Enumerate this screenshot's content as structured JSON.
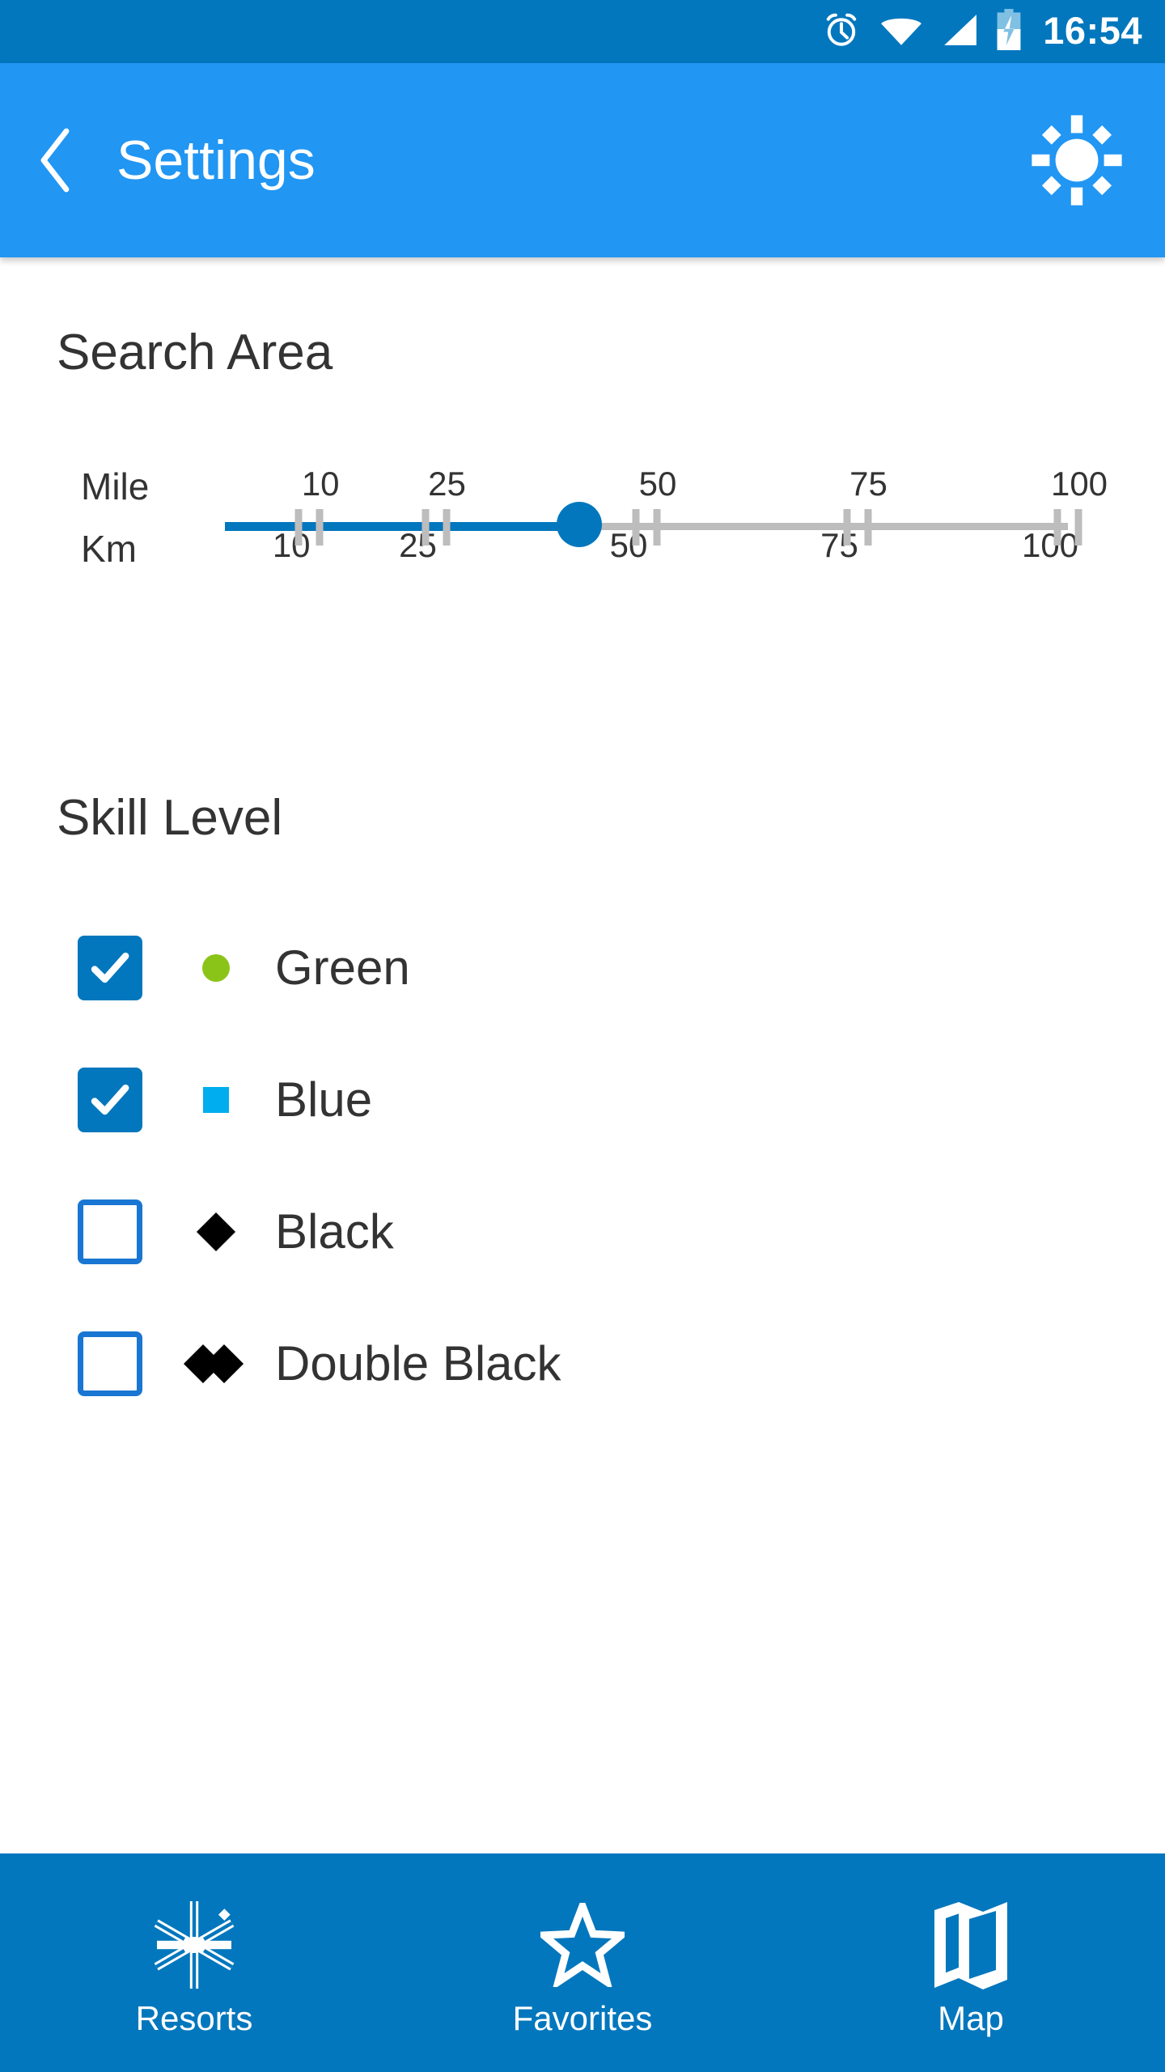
{
  "statusbar": {
    "time": "16:54",
    "icons": [
      "alarm-icon",
      "wifi-icon",
      "signal-icon",
      "battery-charging-icon"
    ],
    "background": "#0277BD"
  },
  "appbar": {
    "title": "Settings",
    "back_icon": "chevron-left-icon",
    "action_icon": "brightness-sun-icon",
    "background": "#2196F3"
  },
  "search_area": {
    "title": "Search Area",
    "unit_primary": "Mile",
    "unit_secondary": "Km",
    "mile_labels": [
      "10",
      "25",
      "50",
      "75",
      "100"
    ],
    "km_labels": [
      "10",
      "25",
      "50",
      "75",
      "100"
    ],
    "value": 42,
    "min": 0,
    "max": 100,
    "track_color": "#BDBDBD",
    "fill_color": "#0277BD",
    "thumb_color": "#0277BD"
  },
  "skill_level": {
    "title": "Skill Level",
    "items": [
      {
        "label": "Green",
        "checked": true,
        "symbol": "circle-icon",
        "color": "#8BC419"
      },
      {
        "label": "Blue",
        "checked": true,
        "symbol": "square-icon",
        "color": "#00ADEE"
      },
      {
        "label": "Black",
        "checked": false,
        "symbol": "diamond-icon",
        "color": "#000000"
      },
      {
        "label": "Double Black",
        "checked": false,
        "symbol": "double-diamond-icon",
        "color": "#000000"
      }
    ]
  },
  "bottomnav": {
    "background": "#0277BD",
    "items": [
      {
        "label": "Resorts",
        "icon": "snowflake-icon"
      },
      {
        "label": "Favorites",
        "icon": "star-icon"
      },
      {
        "label": "Map",
        "icon": "map-icon"
      }
    ]
  }
}
